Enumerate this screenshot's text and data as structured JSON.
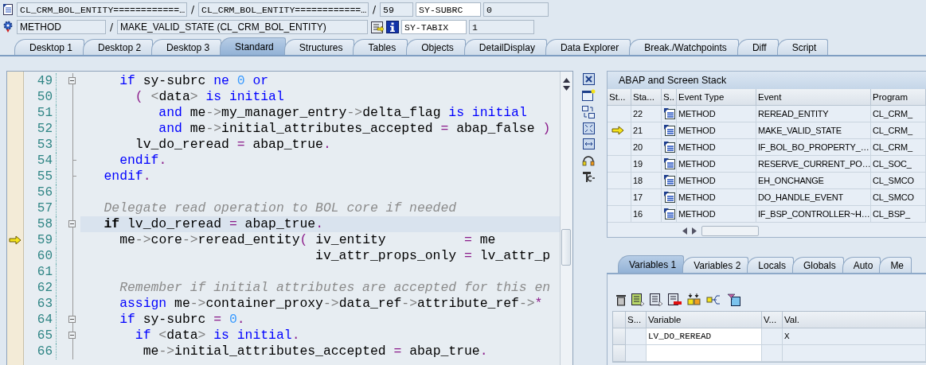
{
  "context": {
    "include": "CL_CRM_BOL_ENTITY============…",
    "program": "CL_CRM_BOL_ENTITY============…",
    "line": "59",
    "event_type": "METHOD",
    "event": "MAKE_VALID_STATE (CL_CRM_BOL_ENTITY)",
    "separators": [
      "/",
      "/",
      "/"
    ],
    "sysvars": [
      {
        "name": "SY-SUBRC",
        "value": "0"
      },
      {
        "name": "SY-TABIX",
        "value": "1"
      }
    ]
  },
  "tabs": [
    {
      "label": "Desktop 1",
      "selected": false
    },
    {
      "label": "Desktop 2",
      "selected": false
    },
    {
      "label": "Desktop 3",
      "selected": false
    },
    {
      "label": "Standard",
      "selected": true
    },
    {
      "label": "Structures",
      "selected": false
    },
    {
      "label": "Tables",
      "selected": false
    },
    {
      "label": "Objects",
      "selected": false
    },
    {
      "label": "DetailDisplay",
      "selected": false
    },
    {
      "label": "Data Explorer",
      "selected": false
    },
    {
      "label": "Break./Watchpoints",
      "selected": false
    },
    {
      "label": "Diff",
      "selected": false
    },
    {
      "label": "Script",
      "selected": false
    }
  ],
  "code": {
    "lines": [
      {
        "number": "49",
        "current": false,
        "highlighted": false,
        "collapsible": true,
        "block_end": false,
        "tokens": [
          {
            "kind": "kw",
            "text": "     if"
          },
          {
            "kind": "id",
            "text": " sy-subrc "
          },
          {
            "kind": "kw",
            "text": "ne "
          },
          {
            "kind": "num",
            "text": "0"
          },
          {
            "kind": "kw",
            "text": " or"
          }
        ]
      },
      {
        "number": "50",
        "current": false,
        "highlighted": false,
        "collapsible": false,
        "block_end": false,
        "tokens": [
          {
            "kind": "op",
            "text": "       ("
          },
          {
            "kind": "arrow",
            "text": " <"
          },
          {
            "kind": "id",
            "text": "data"
          },
          {
            "kind": "arrow",
            "text": ">"
          },
          {
            "kind": "kw",
            "text": " is initial"
          }
        ]
      },
      {
        "number": "51",
        "current": false,
        "highlighted": false,
        "collapsible": false,
        "block_end": false,
        "tokens": [
          {
            "kind": "kw",
            "text": "          and"
          },
          {
            "kind": "id",
            "text": " me"
          },
          {
            "kind": "arrow",
            "text": "->"
          },
          {
            "kind": "id",
            "text": "my_manager_entry"
          },
          {
            "kind": "arrow",
            "text": "->"
          },
          {
            "kind": "id",
            "text": "delta_flag "
          },
          {
            "kind": "kw",
            "text": "is initial"
          }
        ]
      },
      {
        "number": "52",
        "current": false,
        "highlighted": false,
        "collapsible": false,
        "block_end": false,
        "tokens": [
          {
            "kind": "kw",
            "text": "          and"
          },
          {
            "kind": "id",
            "text": " me"
          },
          {
            "kind": "arrow",
            "text": "->"
          },
          {
            "kind": "id",
            "text": "initial_attributes_accepted "
          },
          {
            "kind": "op",
            "text": "="
          },
          {
            "kind": "id",
            "text": " abap_false "
          },
          {
            "kind": "op",
            "text": ")"
          }
        ]
      },
      {
        "number": "53",
        "current": false,
        "highlighted": false,
        "collapsible": false,
        "block_end": false,
        "tokens": [
          {
            "kind": "id",
            "text": "       lv_do_reread "
          },
          {
            "kind": "op",
            "text": "="
          },
          {
            "kind": "id",
            "text": " abap_true"
          },
          {
            "kind": "op",
            "text": "."
          }
        ]
      },
      {
        "number": "54",
        "current": false,
        "highlighted": false,
        "collapsible": false,
        "block_end": true,
        "tokens": [
          {
            "kind": "kw",
            "text": "     endif"
          },
          {
            "kind": "op",
            "text": "."
          }
        ]
      },
      {
        "number": "55",
        "current": false,
        "highlighted": false,
        "collapsible": false,
        "block_end": true,
        "tokens": [
          {
            "kind": "kw",
            "text": "   endif"
          },
          {
            "kind": "op",
            "text": "."
          }
        ]
      },
      {
        "number": "56",
        "current": false,
        "highlighted": false,
        "collapsible": false,
        "block_end": false
      },
      {
        "number": "57",
        "current": false,
        "highlighted": false,
        "collapsible": false,
        "block_end": false,
        "tokens": [
          {
            "kind": "cmt",
            "text": "   Delegate read operation to BOL core if needed"
          }
        ]
      },
      {
        "number": "58",
        "current": false,
        "highlighted": true,
        "collapsible": true,
        "block_end": false,
        "tokens": [
          {
            "kind": "strong",
            "text": "   if"
          },
          {
            "kind": "id",
            "text": " lv_do_reread "
          },
          {
            "kind": "op",
            "text": "="
          },
          {
            "kind": "id",
            "text": " abap_true"
          },
          {
            "kind": "op",
            "text": "."
          }
        ]
      },
      {
        "number": "59",
        "current": true,
        "highlighted": false,
        "collapsible": false,
        "block_end": false,
        "tokens": [
          {
            "kind": "id",
            "text": "     me"
          },
          {
            "kind": "arrow",
            "text": "->"
          },
          {
            "kind": "id",
            "text": "core"
          },
          {
            "kind": "arrow",
            "text": "->"
          },
          {
            "kind": "id",
            "text": "reread_entity"
          },
          {
            "kind": "op",
            "text": "("
          },
          {
            "kind": "id",
            "text": " iv_entity          "
          },
          {
            "kind": "op",
            "text": "="
          },
          {
            "kind": "id",
            "text": " me"
          }
        ]
      },
      {
        "number": "60",
        "current": false,
        "highlighted": false,
        "collapsible": false,
        "block_end": false,
        "tokens": [
          {
            "kind": "id",
            "text": "                              iv_attr_props_only "
          },
          {
            "kind": "op",
            "text": "="
          },
          {
            "kind": "id",
            "text": " lv_attr_p"
          }
        ]
      },
      {
        "number": "61",
        "current": false,
        "highlighted": false,
        "collapsible": false,
        "block_end": false
      },
      {
        "number": "62",
        "current": false,
        "highlighted": false,
        "collapsible": false,
        "block_end": false,
        "tokens": [
          {
            "kind": "cmt",
            "text": "     Remember if initial attributes are accepted for this en"
          }
        ]
      },
      {
        "number": "63",
        "current": false,
        "highlighted": false,
        "collapsible": false,
        "block_end": false,
        "tokens": [
          {
            "kind": "kw",
            "text": "     assign"
          },
          {
            "kind": "id",
            "text": " me"
          },
          {
            "kind": "arrow",
            "text": "->"
          },
          {
            "kind": "id",
            "text": "container_proxy"
          },
          {
            "kind": "arrow",
            "text": "->"
          },
          {
            "kind": "id",
            "text": "data_ref"
          },
          {
            "kind": "arrow",
            "text": "->"
          },
          {
            "kind": "id",
            "text": "attribute_ref"
          },
          {
            "kind": "arrow",
            "text": "->"
          },
          {
            "kind": "op",
            "text": "*"
          }
        ]
      },
      {
        "number": "64",
        "current": false,
        "highlighted": false,
        "collapsible": true,
        "block_end": false,
        "tokens": [
          {
            "kind": "kw",
            "text": "     if"
          },
          {
            "kind": "id",
            "text": " sy-subrc "
          },
          {
            "kind": "op",
            "text": "="
          },
          {
            "kind": "num",
            "text": " 0"
          },
          {
            "kind": "op",
            "text": "."
          }
        ]
      },
      {
        "number": "65",
        "current": false,
        "highlighted": false,
        "collapsible": true,
        "block_end": false,
        "tokens": [
          {
            "kind": "kw",
            "text": "       if"
          },
          {
            "kind": "arrow",
            "text": " <"
          },
          {
            "kind": "id",
            "text": "data"
          },
          {
            "kind": "arrow",
            "text": ">"
          },
          {
            "kind": "kw",
            "text": " is initial"
          },
          {
            "kind": "op",
            "text": "."
          }
        ]
      },
      {
        "number": "66",
        "current": false,
        "highlighted": false,
        "collapsible": false,
        "block_end": false,
        "tokens": [
          {
            "kind": "id",
            "text": "        me"
          },
          {
            "kind": "arrow",
            "text": "->"
          },
          {
            "kind": "id",
            "text": "initial_attributes_accepted "
          },
          {
            "kind": "op",
            "text": "="
          },
          {
            "kind": "id",
            "text": " abap_true"
          },
          {
            "kind": "op",
            "text": "."
          }
        ]
      }
    ]
  },
  "stack": {
    "title": "ABAP and Screen Stack",
    "columns": [
      "St...",
      "Sta...",
      "S..",
      "Event Type",
      "Event",
      "Program"
    ],
    "rows": [
      {
        "current": false,
        "level": "22",
        "event_type": "METHOD",
        "event": "REREAD_ENTITY",
        "program": "CL_CRM_"
      },
      {
        "current": true,
        "level": "21",
        "event_type": "METHOD",
        "event": "MAKE_VALID_STATE",
        "program": "CL_CRM_"
      },
      {
        "current": false,
        "level": "20",
        "event_type": "METHOD",
        "event": "IF_BOL_BO_PROPERTY_…",
        "program": "CL_CRM_"
      },
      {
        "current": false,
        "level": "19",
        "event_type": "METHOD",
        "event": "RESERVE_CURRENT_PO…",
        "program": "CL_SOC_"
      },
      {
        "current": false,
        "level": "18",
        "event_type": "METHOD",
        "event": "EH_ONCHANGE",
        "program": "CL_SMCO"
      },
      {
        "current": false,
        "level": "17",
        "event_type": "METHOD",
        "event": "DO_HANDLE_EVENT",
        "program": "CL_SMCO"
      },
      {
        "current": false,
        "level": "16",
        "event_type": "METHOD",
        "event": "IF_BSP_CONTROLLER~H…",
        "program": "CL_BSP_"
      }
    ]
  },
  "variables": {
    "tabs": [
      {
        "label": "Variables 1",
        "selected": true
      },
      {
        "label": "Variables 2",
        "selected": false
      },
      {
        "label": "Locals",
        "selected": false
      },
      {
        "label": "Globals",
        "selected": false
      },
      {
        "label": "Auto",
        "selected": false
      },
      {
        "label": "Me",
        "selected": false
      }
    ],
    "columns": [
      "S...",
      "Variable",
      "V...",
      "Val."
    ],
    "rows": [
      {
        "variable": "LV_DO_REREAD",
        "value": "X"
      }
    ]
  }
}
